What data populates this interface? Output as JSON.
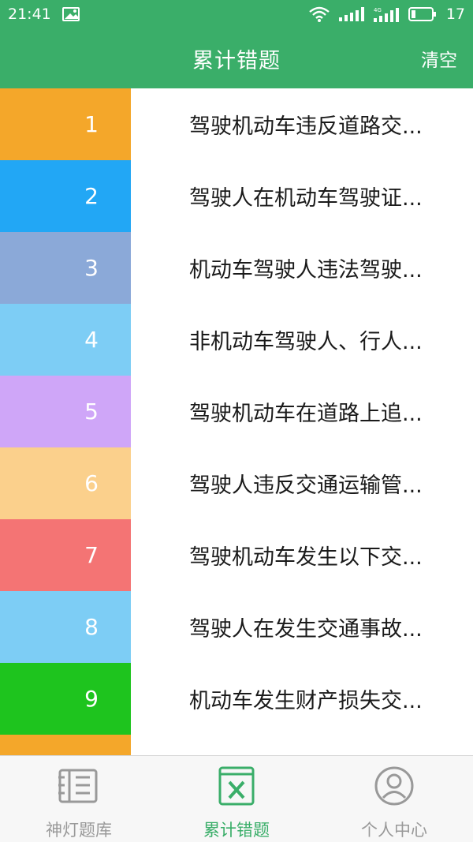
{
  "status": {
    "time": "21:41",
    "battery": "17"
  },
  "header": {
    "title": "累计错题",
    "clear_label": "清空"
  },
  "colors": {
    "accent": "#3aae69"
  },
  "rows": [
    {
      "num": "1",
      "text": "驾驶机动车违反道路交...",
      "color": "#f4a72a"
    },
    {
      "num": "2",
      "text": "驾驶人在机动车驾驶证...",
      "color": "#22a7f5"
    },
    {
      "num": "3",
      "text": "机动车驾驶人违法驾驶...",
      "color": "#8ba9d8"
    },
    {
      "num": "4",
      "text": "非机动车驾驶人、行人...",
      "color": "#7dcdf5"
    },
    {
      "num": "5",
      "text": "驾驶机动车在道路上追...",
      "color": "#cfa6f8"
    },
    {
      "num": "6",
      "text": "驾驶人违反交通运输管...",
      "color": "#fbd08c"
    },
    {
      "num": "7",
      "text": "驾驶机动车发生以下交...",
      "color": "#f47474"
    },
    {
      "num": "8",
      "text": "驾驶人在发生交通事故...",
      "color": "#7dcdf5"
    },
    {
      "num": "9",
      "text": "机动车发生财产损失交...",
      "color": "#1ec41e"
    },
    {
      "num": "",
      "text": "",
      "color": "#f4a72a"
    }
  ],
  "tabs": [
    {
      "label": "神灯题库",
      "icon": "book-icon"
    },
    {
      "label": "累计错题",
      "icon": "wrong-list-icon"
    },
    {
      "label": "个人中心",
      "icon": "user-icon"
    }
  ]
}
